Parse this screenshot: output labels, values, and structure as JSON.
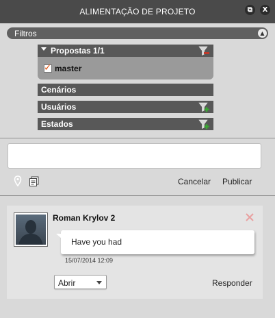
{
  "window": {
    "title": "ALIMENTAÇÃO DE PROJETO",
    "restore_glyph": "⧉",
    "close_glyph": "X"
  },
  "filters": {
    "label": "Filtros",
    "collapse_glyph": "▲",
    "sections": {
      "proposals": {
        "label": "Propostas 1/1",
        "expanded": true,
        "filter_icon": "funnel-remove-icon"
      },
      "scenarios": {
        "label": "Cenários"
      },
      "users": {
        "label": "Usuários",
        "filter_icon": "funnel-add-icon"
      },
      "states": {
        "label": "Estados",
        "filter_icon": "funnel-add-icon"
      }
    },
    "proposal_items": [
      {
        "label": "master",
        "checked": true
      }
    ]
  },
  "composer": {
    "value": "",
    "location_icon": "location-pin-icon",
    "attach_icon": "document-icon",
    "cancel_label": "Cancelar",
    "publish_label": "Publicar"
  },
  "comment": {
    "author": "Roman Krylov 2",
    "text": "Have you had",
    "timestamp": "15/07/2014 12:09",
    "status_value": "Abrir",
    "reply_label": "Responder",
    "delete_icon": "delete-x-icon"
  },
  "colors": {
    "titlebar": "#4a4a4a",
    "section_header": "#585858",
    "accent_red": "#c0392b",
    "accent_green": "#3aa832",
    "check_orange": "#e05a1a"
  }
}
